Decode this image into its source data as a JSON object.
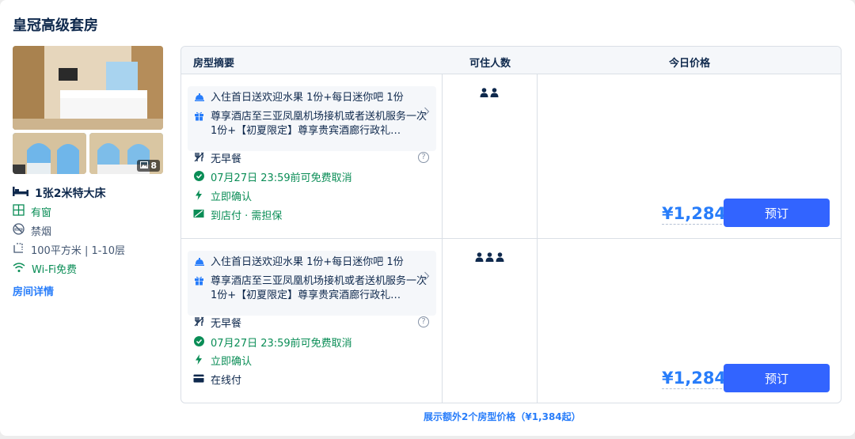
{
  "room": {
    "title": "皇冠高级套房",
    "photo_count": "8",
    "bed": "1张2米特大床",
    "features": [
      {
        "icon": "window-icon",
        "text": "有窗",
        "highlight": true
      },
      {
        "icon": "no-smoking-icon",
        "text": "禁烟",
        "highlight": false
      },
      {
        "icon": "area-icon",
        "text": "100平方米 | 1-10层",
        "highlight": false
      },
      {
        "icon": "wifi-icon",
        "text": "Wi-Fi免费",
        "highlight": true
      }
    ],
    "details_link": "房间详情"
  },
  "table": {
    "headers": {
      "summary": "房型摘要",
      "occupancy": "可住人数",
      "price": "今日价格"
    },
    "rows": [
      {
        "perk1": "入住首日送欢迎水果 1份+每日迷你吧 1份",
        "perk2": "尊享酒店至三亚凤凰机场接机或者送机服务一次 1份+【初夏限定】尊享贵宾酒廊行政礼…",
        "meal": "无早餐",
        "cancel": "07月27日 23:59前可免费取消",
        "confirm": "立即确认",
        "payment": "到店付 · 需担保",
        "guests": 2,
        "price": "¥1,284",
        "book_label": "预订"
      },
      {
        "perk1": "入住首日送欢迎水果 1份+每日迷你吧 1份",
        "perk2": "尊享酒店至三亚凤凰机场接机或者送机服务一次 1份+【初夏限定】尊享贵宾酒廊行政礼…",
        "meal": "无早餐",
        "cancel": "07月27日 23:59前可免费取消",
        "confirm": "立即确认",
        "payment": "在线付",
        "guests": 3,
        "price": "¥1,284",
        "book_label": "预订"
      }
    ]
  },
  "more_link": "展示额外2个房型价格（¥1,384起）",
  "colors": {
    "accent": "#287dfa",
    "button": "#3264ff",
    "green": "#0a8d56",
    "text": "#0f294d"
  }
}
